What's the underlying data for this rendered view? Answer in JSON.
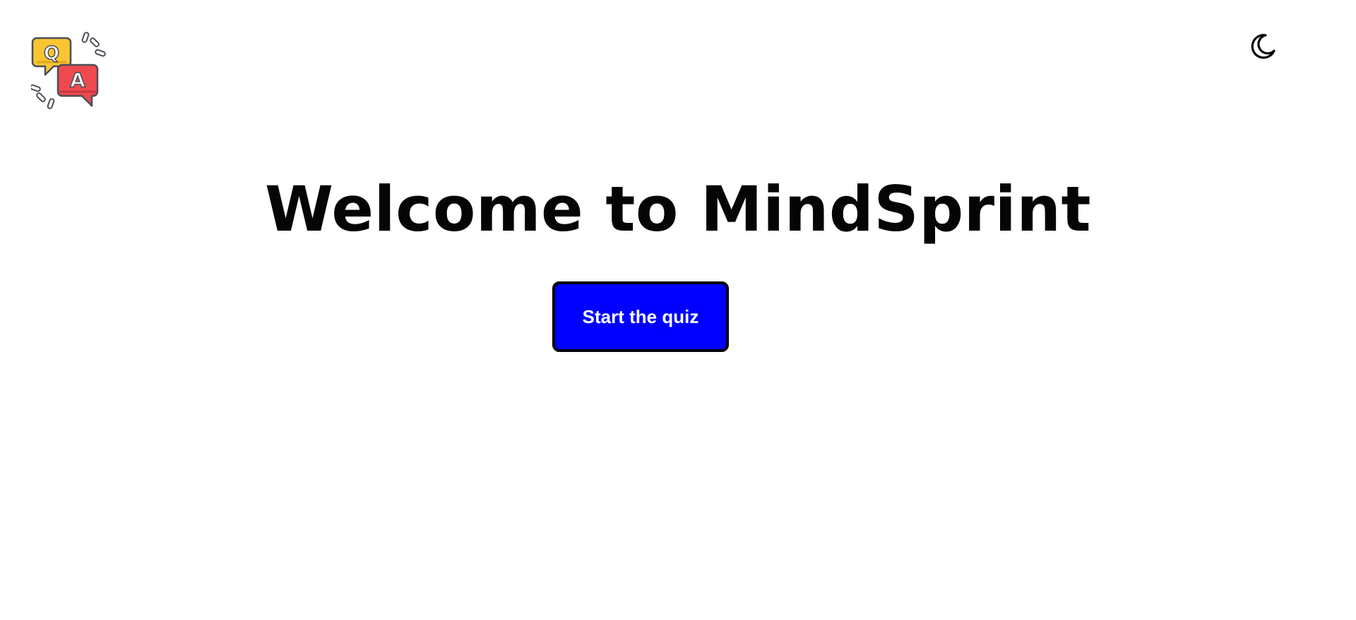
{
  "header": {
    "logo": {
      "icon": "qa-chat-bubbles-icon",
      "question_letter": "Q",
      "answer_letter": "A",
      "colors": {
        "question_bubble": "#f9c531",
        "answer_bubble": "#ee4a4f",
        "outline": "#4a4f57"
      }
    },
    "theme_toggle": {
      "icon": "moon-icon"
    }
  },
  "main": {
    "title": "Welcome to MindSprint",
    "start_button_label": "Start the quiz",
    "colors": {
      "button_background": "#0000ff",
      "button_border": "#000000",
      "button_text": "#ffffff",
      "title_text": "#050505"
    }
  }
}
